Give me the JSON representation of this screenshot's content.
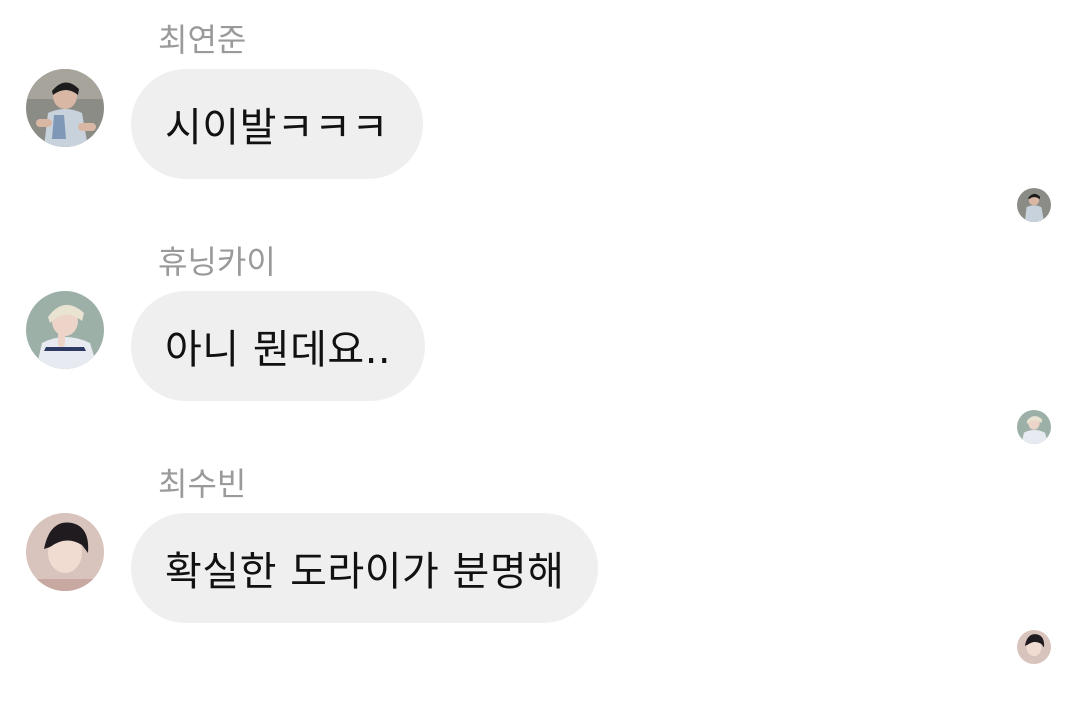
{
  "messages": [
    {
      "sender": "최연준",
      "text": "시이발ㅋㅋㅋ",
      "avatar_icon": "profile-photo-person-sitting",
      "read_receipt_icon": "read-receipt-avatar"
    },
    {
      "sender": "휴닝카이",
      "text": "아니 뭔데요..",
      "avatar_icon": "profile-photo-blond-person",
      "read_receipt_icon": "read-receipt-avatar"
    },
    {
      "sender": "최수빈",
      "text": "확실한 도라이가 분명해",
      "avatar_icon": "profile-photo-dark-hair-person",
      "read_receipt_icon": "read-receipt-avatar"
    }
  ],
  "colors": {
    "background": "#ffffff",
    "bubble": "#efefef",
    "sender_name": "#9a9a9a",
    "message_text": "#111111"
  }
}
